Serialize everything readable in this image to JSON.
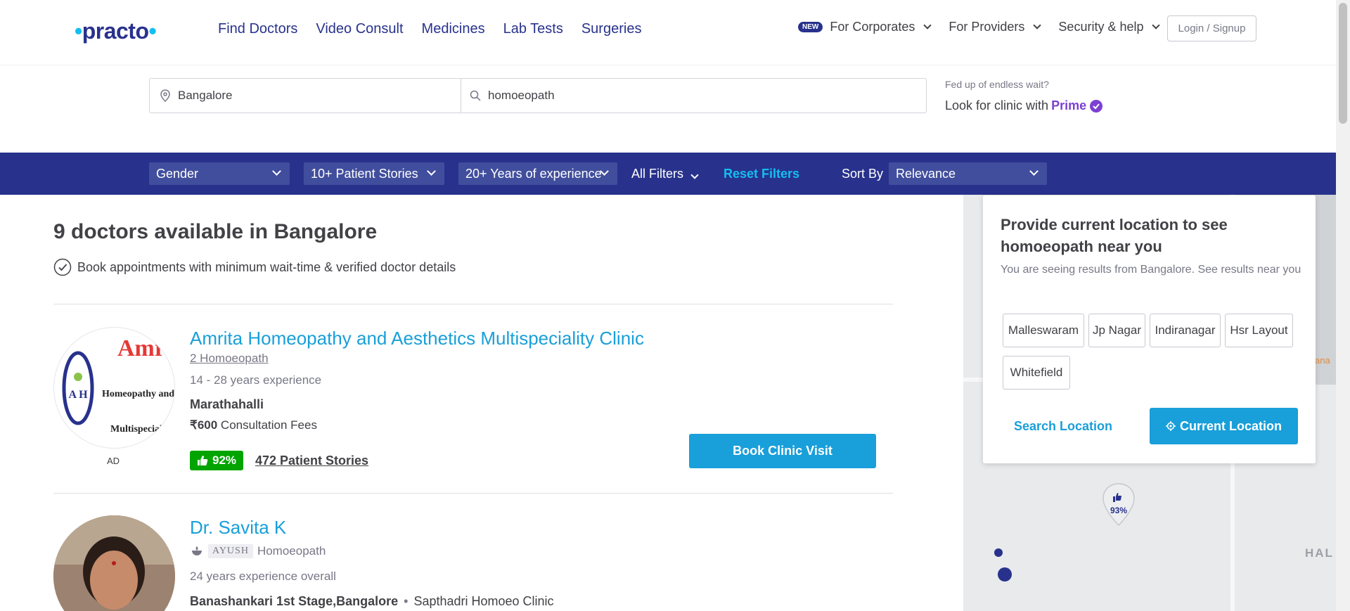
{
  "header": {
    "logo": "practo",
    "nav": [
      "Find Doctors",
      "Video Consult",
      "Medicines",
      "Lab Tests",
      "Surgeries"
    ],
    "new_badge": "NEW",
    "right_nav": [
      "For Corporates",
      "For Providers",
      "Security & help"
    ],
    "login": "Login / Signup"
  },
  "search": {
    "location": "Bangalore",
    "query": "homoeopath"
  },
  "prime": {
    "line1": "Fed up of endless wait?",
    "line2": "Look for clinic with",
    "prime": "Prime"
  },
  "filters": {
    "gender": "Gender",
    "stories": "10+ Patient Stories",
    "experience": "20+ Years of experience",
    "all": "All Filters",
    "reset": "Reset Filters",
    "sort_label": "Sort By",
    "sort_value": "Relevance"
  },
  "results": {
    "heading": "9 doctors available in Bangalore",
    "subheading": "Book appointments with minimum wait-time & verified doctor details"
  },
  "cards": [
    {
      "name": "Amrita Homeopathy and Aesthetics Multispeciality Clinic",
      "spec": "2 Homoeopath",
      "exp": "14 - 28 years experience",
      "loc": "Marathahalli",
      "fee_amount": "₹600",
      "fee_label": "Consultation Fees",
      "rating": "92%",
      "stories": "472 Patient Stories",
      "book": "Book Clinic Visit",
      "ad": "AD",
      "logo_text": [
        "Amrita...",
        "Homeopathy and Aesthetic",
        "Multispeciality clinic"
      ]
    },
    {
      "name": "Dr. Savita K",
      "ayush": "AYUSH",
      "spec": "Homoeopath",
      "exp": "24 years experience overall",
      "loc": "Banashankari 1st Stage,Bangalore",
      "clinic": "Sapthadri Homoeo Clinic"
    }
  ],
  "location_card": {
    "title": "Provide current location to see homoeopath near you",
    "subtitle": "You are seeing results from Bangalore. See results near you",
    "chips": [
      "Malleswaram",
      "Jp Nagar",
      "Indiranagar",
      "Hsr Layout",
      "Whitefield"
    ],
    "search_location": "Search Location",
    "current_location": "Current Location"
  },
  "map": {
    "pin_rating": "93%",
    "label_hal": "HAL",
    "label_ana": "ana"
  }
}
